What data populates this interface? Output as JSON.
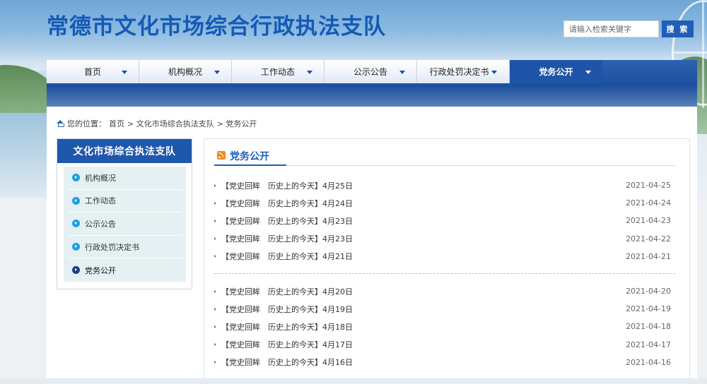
{
  "header": {
    "site_title": "常德市文化市场综合行政执法支队",
    "search_placeholder": "请输入检索关键字",
    "search_button": "搜 索"
  },
  "nav": {
    "items": [
      {
        "label": "首页"
      },
      {
        "label": "机构概况"
      },
      {
        "label": "工作动态"
      },
      {
        "label": "公示公告"
      },
      {
        "label": "行政处罚决定书"
      },
      {
        "label": "党务公开",
        "active": true
      }
    ]
  },
  "breadcrumb": {
    "prefix": "您的位置：",
    "path": [
      "首页",
      "> 文化市场综合执法支队",
      "> 党务公开"
    ]
  },
  "sidebar": {
    "title": "文化市场综合执法支队",
    "items": [
      {
        "label": "机构概况"
      },
      {
        "label": "工作动态"
      },
      {
        "label": "公示公告"
      },
      {
        "label": "行政处罚决定书"
      },
      {
        "label": "党务公开",
        "active": true
      }
    ]
  },
  "main": {
    "title": "党务公开",
    "group1": [
      {
        "title": "【党史回眸　历史上的今天】4月25日",
        "date": "2021-04-25"
      },
      {
        "title": "【党史回眸　历史上的今天】4月24日",
        "date": "2021-04-24"
      },
      {
        "title": "【党史回眸　历史上的今天】4月23日",
        "date": "2021-04-23"
      },
      {
        "title": "【党史回眸　历史上的今天】4月23日",
        "date": "2021-04-22"
      },
      {
        "title": "【党史回眸　历史上的今天】4月21日",
        "date": "2021-04-21"
      }
    ],
    "group2": [
      {
        "title": "【党史回眸　历史上的今天】4月20日",
        "date": "2021-04-20"
      },
      {
        "title": "【党史回眸　历史上的今天】4月19日",
        "date": "2021-04-19"
      },
      {
        "title": "【党史回眸　历史上的今天】4月18日",
        "date": "2021-04-18"
      },
      {
        "title": "【党史回眸　历史上的今天】4月17日",
        "date": "2021-04-17"
      },
      {
        "title": "【党史回眸　历史上的今天】4月16日",
        "date": "2021-04-16"
      }
    ]
  },
  "colors": {
    "brand_blue": "#1559b5",
    "nav_active": "#1f54a8",
    "rss_orange": "#f08a24"
  }
}
